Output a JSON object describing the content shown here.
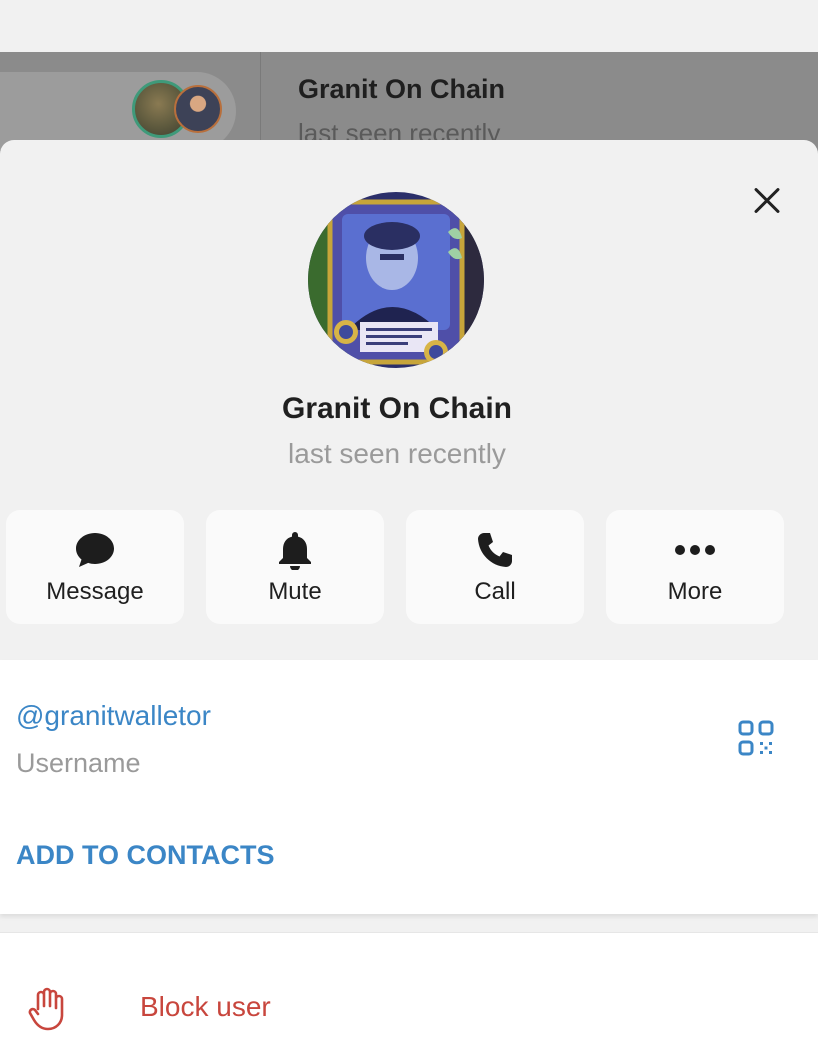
{
  "background_chat": {
    "title": "Granit On Chain",
    "subtitle": "last seen recently"
  },
  "profile": {
    "name": "Granit On Chain",
    "status": "last seen recently",
    "close_icon": "close-icon"
  },
  "actions": [
    {
      "label": "Message",
      "icon": "message-bubble-icon"
    },
    {
      "label": "Mute",
      "icon": "bell-icon"
    },
    {
      "label": "Call",
      "icon": "phone-icon"
    },
    {
      "label": "More",
      "icon": "more-dots-icon"
    }
  ],
  "info": {
    "username": "@granitwalletor",
    "username_label": "Username",
    "qr_icon": "qr-code-icon",
    "add_contacts": "ADD TO CONTACTS"
  },
  "block": {
    "label": "Block user",
    "icon": "hand-stop-icon"
  },
  "colors": {
    "accent": "#3b86c6",
    "danger": "#c8463d",
    "sheet_bg": "#f1f1f1",
    "card_bg": "#fafafa"
  }
}
